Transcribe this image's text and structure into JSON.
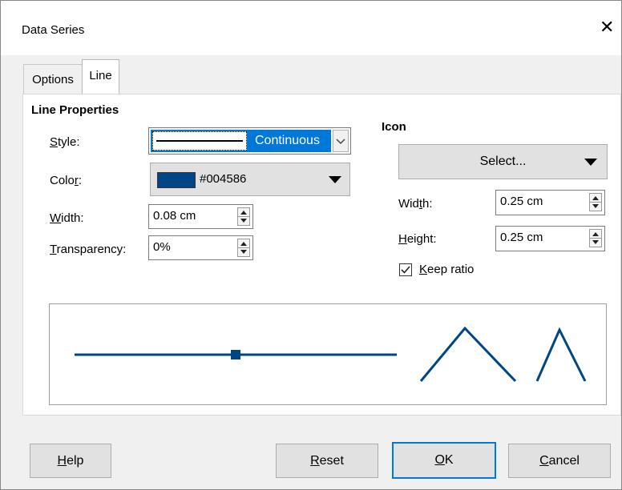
{
  "dialog": {
    "title": "Data Series",
    "close_glyph": "✕"
  },
  "tabs": [
    {
      "label": "Options",
      "active": false
    },
    {
      "label": "Line",
      "active": true
    }
  ],
  "line_properties": {
    "heading": "Line Properties",
    "style": {
      "label_prefix": "",
      "label_mnemonic": "S",
      "label_rest": "tyle:",
      "value": "Continuous"
    },
    "color": {
      "label_prefix": "Colo",
      "label_mnemonic": "r",
      "label_rest": ":",
      "value": "#004586",
      "swatch": "#004586"
    },
    "width": {
      "label_prefix": "",
      "label_mnemonic": "W",
      "label_rest": "idth:",
      "value": "0.08 cm"
    },
    "transparency": {
      "label_prefix": "",
      "label_mnemonic": "T",
      "label_rest": "ransparency:",
      "value": "0%"
    }
  },
  "icon": {
    "heading": "Icon",
    "select_label": "Select...",
    "width": {
      "label_prefix": "Wid",
      "label_mnemonic": "t",
      "label_rest": "h:",
      "value": "0.25 cm"
    },
    "height": {
      "label_prefix": "",
      "label_mnemonic": "H",
      "label_rest": "eight:",
      "value": "0.25 cm"
    },
    "keep_ratio": {
      "label_prefix": "",
      "label_mnemonic": "K",
      "label_rest": "eep ratio",
      "checked": true
    }
  },
  "buttons": {
    "help": {
      "mnemonic": "H",
      "rest": "elp"
    },
    "reset": {
      "mnemonic": "R",
      "rest": "eset"
    },
    "ok": {
      "mnemonic": "O",
      "rest": "K"
    },
    "cancel": {
      "mnemonic": "C",
      "rest": "ancel"
    }
  },
  "colors": {
    "line_color": "#004586",
    "accent_border": "#0078d7"
  },
  "icons": [
    "close-icon",
    "chevron-down-icon",
    "dropdown-arrow-icon",
    "spin-up-icon",
    "spin-down-icon",
    "checkbox-checked-icon"
  ]
}
